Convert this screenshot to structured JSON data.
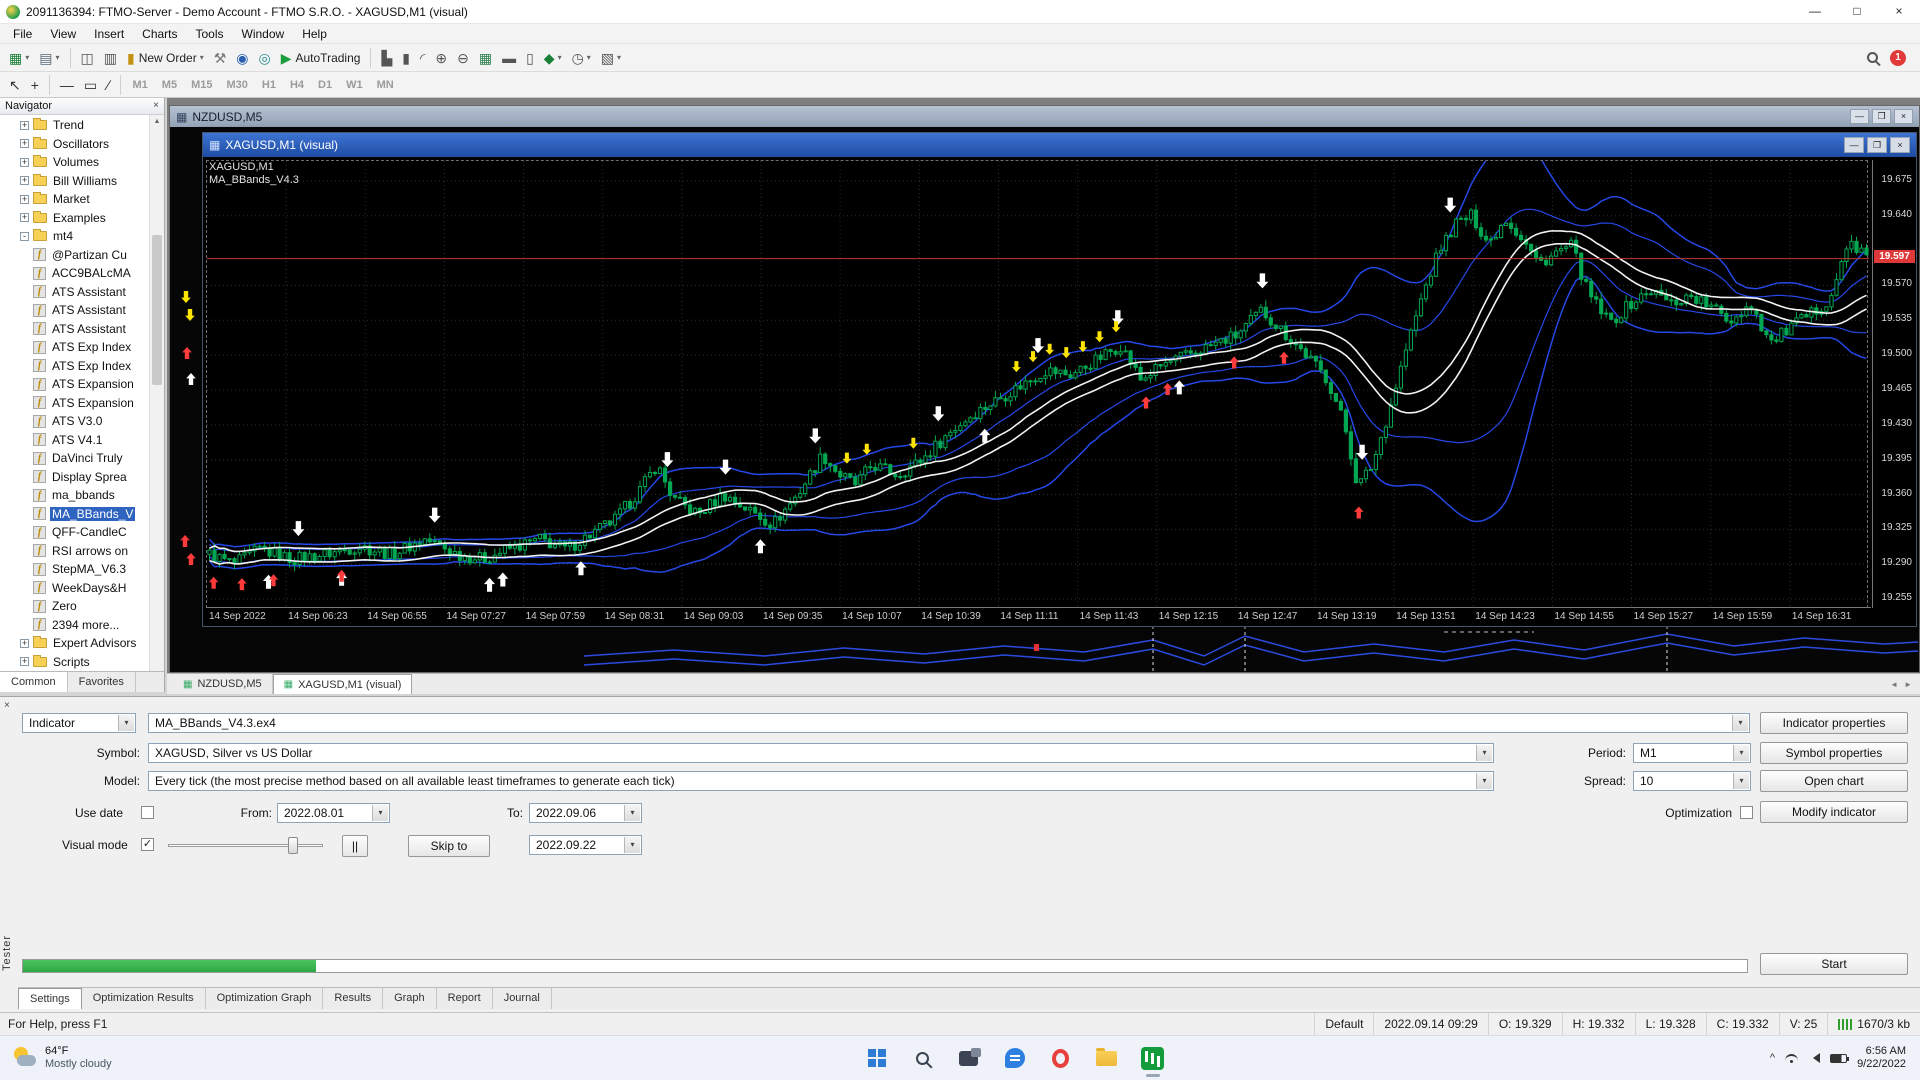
{
  "window": {
    "title": "2091136394: FTMO-Server - Demo Account - FTMO S.R.O. - XAGUSD,M1 (visual)"
  },
  "icons": {
    "minimize": "—",
    "maximize": "□",
    "close": "×",
    "restore": "❐",
    "dropdown": "▾",
    "expand": "+",
    "collapse": "-",
    "check": "✓",
    "left": "◄",
    "right": "►",
    "up": "▲",
    "down": "▼",
    "chart": "▦",
    "chevron_up": "^"
  },
  "menu": [
    "File",
    "View",
    "Insert",
    "Charts",
    "Tools",
    "Window",
    "Help"
  ],
  "toolbar": {
    "notification_count": "1",
    "timeframes": [
      "M1",
      "M5",
      "M15",
      "M30",
      "H1",
      "H4",
      "D1",
      "W1",
      "MN"
    ]
  },
  "toolbar_main": [
    {
      "name": "new-chart",
      "glyph": "▦",
      "color": "#1a7f37",
      "dd": true
    },
    {
      "name": "profiles",
      "glyph": "▤",
      "color": "#5a6a7a",
      "dd": true
    },
    {
      "name": "separator"
    },
    {
      "name": "market-watch",
      "glyph": "◫",
      "color": "#555"
    },
    {
      "name": "data-window",
      "glyph": "▥",
      "color": "#555"
    },
    {
      "name": "new-order",
      "glyph": "▮",
      "color": "#c49110",
      "label": "New Order",
      "dd": true
    },
    {
      "name": "metaeditor",
      "glyph": "⚒",
      "color": "#777"
    },
    {
      "name": "expert-advisors",
      "glyph": "◉",
      "color": "#2b5fb0"
    },
    {
      "name": "options",
      "glyph": "◎",
      "color": "#2a8f8f"
    },
    {
      "name": "autotrading",
      "glyph": "▶",
      "color": "#1a9f3c",
      "label": "AutoTrading"
    },
    {
      "name": "separator"
    },
    {
      "name": "chart-bars",
      "glyph": "▙",
      "color": "#555"
    },
    {
      "name": "chart-candles",
      "glyph": "▮",
      "color": "#555"
    },
    {
      "name": "chart-line",
      "glyph": "◜",
      "color": "#555"
    },
    {
      "name": "zoom-in",
      "glyph": "⊕",
      "color": "#555"
    },
    {
      "name": "zoom-out",
      "glyph": "⊖",
      "color": "#555"
    },
    {
      "name": "tile-windows",
      "glyph": "▦",
      "color": "#2a7f4f"
    },
    {
      "name": "tile-horizontal",
      "glyph": "▬",
      "color": "#555"
    },
    {
      "name": "tile-vertical",
      "glyph": "▯",
      "color": "#555"
    },
    {
      "name": "indicators",
      "glyph": "◆",
      "color": "#1a7f37",
      "dd": true
    },
    {
      "name": "periods",
      "glyph": "◷",
      "color": "#555",
      "dd": true
    },
    {
      "name": "templates",
      "glyph": "▧",
      "color": "#555",
      "dd": true
    }
  ],
  "toolbar_draw": [
    {
      "name": "cursor",
      "glyph": "↖",
      "color": "#333"
    },
    {
      "name": "crosshair",
      "glyph": "+",
      "color": "#333"
    },
    {
      "name": "separator"
    },
    {
      "name": "horizontal-line",
      "glyph": "—",
      "color": "#333"
    },
    {
      "name": "shapes",
      "glyph": "▭",
      "color": "#333"
    },
    {
      "name": "trendline",
      "glyph": "∕",
      "color": "#333"
    },
    {
      "name": "separator"
    }
  ],
  "navigator": {
    "title": "Navigator",
    "folders": [
      "Trend",
      "Oscillators",
      "Volumes",
      "Bill Williams",
      "Market",
      "Examples",
      "mt4"
    ],
    "indicators": [
      "@Partizan Cu",
      "ACC9BALcMA",
      "ATS Assistant",
      "ATS Assistant",
      "ATS Assistant",
      "ATS Exp Index",
      "ATS Exp Index",
      "ATS Expansion",
      "ATS Expansion",
      "ATS V3.0",
      "ATS V4.1",
      "DaVinci Truly",
      "Display Sprea",
      "ma_bbands",
      "MA_BBands_V",
      "QFF-CandleC",
      "RSI arrows on",
      "StepMA_V6.3",
      "WeekDays&H",
      "Zero",
      "2394 more..."
    ],
    "selected_indicator": "MA_BBands_V",
    "bottom_folders": [
      "Expert Advisors",
      "Scripts"
    ],
    "tabs": [
      "Common",
      "Favorites"
    ],
    "active_tab": "Common"
  },
  "charts": {
    "background_window_title": "NZDUSD,M5",
    "active_window_title": "XAGUSD,M1 (visual)",
    "overlay_line1": "XAGUSD,M1",
    "overlay_line2": "MA_BBands_V4.3",
    "current_price": "19.597",
    "price_labels": [
      "19.675",
      "19.640",
      "19.570",
      "19.535",
      "19.500",
      "19.465",
      "19.430",
      "19.395",
      "19.360",
      "19.325",
      "19.290",
      "19.255"
    ],
    "time_labels": [
      "14 Sep 2022",
      "14 Sep 06:23",
      "14 Sep 06:55",
      "14 Sep 07:27",
      "14 Sep 07:59",
      "14 Sep 08:31",
      "14 Sep 09:03",
      "14 Sep 09:35",
      "14 Sep 10:07",
      "14 Sep 10:39",
      "14 Sep 11:11",
      "14 Sep 11:43",
      "14 Sep 12:15",
      "14 Sep 12:47",
      "14 Sep 13:19",
      "14 Sep 13:51",
      "14 Sep 14:23",
      "14 Sep 14:55",
      "14 Sep 15:27",
      "14 Sep 15:59",
      "14 Sep 16:31"
    ],
    "tabs": [
      "NZDUSD,M5",
      "XAGUSD,M1 (visual)"
    ],
    "active_tab": "XAGUSD,M1 (visual)"
  },
  "chart_data": {
    "type": "candlestick",
    "symbol": "XAGUSD",
    "timeframe": "M1",
    "y_range": [
      19.245,
      19.695
    ],
    "price_path": [
      [
        0.0,
        19.3
      ],
      [
        0.015,
        19.29
      ],
      [
        0.03,
        19.305
      ],
      [
        0.05,
        19.295
      ],
      [
        0.07,
        19.3
      ],
      [
        0.09,
        19.308
      ],
      [
        0.11,
        19.3
      ],
      [
        0.13,
        19.315
      ],
      [
        0.15,
        19.3
      ],
      [
        0.165,
        19.295
      ],
      [
        0.18,
        19.305
      ],
      [
        0.2,
        19.315
      ],
      [
        0.215,
        19.305
      ],
      [
        0.23,
        19.32
      ],
      [
        0.245,
        19.335
      ],
      [
        0.26,
        19.365
      ],
      [
        0.27,
        19.39
      ],
      [
        0.28,
        19.355
      ],
      [
        0.295,
        19.34
      ],
      [
        0.31,
        19.36
      ],
      [
        0.325,
        19.345
      ],
      [
        0.34,
        19.33
      ],
      [
        0.355,
        19.36
      ],
      [
        0.37,
        19.4
      ],
      [
        0.38,
        19.38
      ],
      [
        0.39,
        19.37
      ],
      [
        0.4,
        19.39
      ],
      [
        0.415,
        19.38
      ],
      [
        0.43,
        19.395
      ],
      [
        0.445,
        19.42
      ],
      [
        0.46,
        19.44
      ],
      [
        0.475,
        19.455
      ],
      [
        0.49,
        19.47
      ],
      [
        0.505,
        19.485
      ],
      [
        0.52,
        19.48
      ],
      [
        0.535,
        19.495
      ],
      [
        0.55,
        19.51
      ],
      [
        0.562,
        19.475
      ],
      [
        0.575,
        19.49
      ],
      [
        0.59,
        19.5
      ],
      [
        0.605,
        19.51
      ],
      [
        0.62,
        19.52
      ],
      [
        0.635,
        19.545
      ],
      [
        0.65,
        19.52
      ],
      [
        0.662,
        19.5
      ],
      [
        0.675,
        19.475
      ],
      [
        0.685,
        19.43
      ],
      [
        0.693,
        19.368
      ],
      [
        0.702,
        19.39
      ],
      [
        0.712,
        19.445
      ],
      [
        0.722,
        19.505
      ],
      [
        0.732,
        19.56
      ],
      [
        0.742,
        19.605
      ],
      [
        0.752,
        19.632
      ],
      [
        0.762,
        19.64
      ],
      [
        0.772,
        19.612
      ],
      [
        0.782,
        19.638
      ],
      [
        0.792,
        19.618
      ],
      [
        0.802,
        19.592
      ],
      [
        0.812,
        19.602
      ],
      [
        0.822,
        19.61
      ],
      [
        0.832,
        19.562
      ],
      [
        0.845,
        19.532
      ],
      [
        0.858,
        19.552
      ],
      [
        0.87,
        19.565
      ],
      [
        0.882,
        19.552
      ],
      [
        0.894,
        19.56
      ],
      [
        0.906,
        19.548
      ],
      [
        0.918,
        19.535
      ],
      [
        0.93,
        19.552
      ],
      [
        0.942,
        19.512
      ],
      [
        0.954,
        19.528
      ],
      [
        0.966,
        19.54
      ],
      [
        0.978,
        19.558
      ],
      [
        0.99,
        19.615
      ],
      [
        1.0,
        19.598
      ]
    ],
    "signals": {
      "white_down": [
        0.055,
        0.137,
        0.277,
        0.312,
        0.366,
        0.44,
        0.5,
        0.548,
        0.635,
        0.695,
        0.748
      ],
      "white_up": [
        0.037,
        0.081,
        0.17,
        0.178,
        0.225,
        0.333,
        0.468,
        0.585
      ],
      "red_up": [
        0.004,
        0.021,
        0.04,
        0.081,
        0.565,
        0.578,
        0.618,
        0.648,
        0.693
      ],
      "yellow_down": [
        0.385,
        0.397,
        0.425,
        0.487,
        0.497,
        0.507,
        0.517,
        0.527,
        0.537,
        0.547
      ]
    }
  },
  "tester": {
    "panel_label": "Tester",
    "type_value": "Indicator",
    "indicator_value": "MA_BBands_V4.3.ex4",
    "symbol_label": "Symbol:",
    "symbol_value": "XAGUSD, Silver vs US Dollar",
    "model_label": "Model:",
    "model_value": "Every tick (the most precise method based on all available least timeframes to generate each tick)",
    "use_date_label": "Use date",
    "from_label": "From:",
    "from_value": "2022.08.01",
    "to_label": "To:",
    "to_value": "2022.09.06",
    "visual_mode_label": "Visual mode",
    "pause_label": "||",
    "skip_to_label": "Skip to",
    "skip_to_value": "2022.09.22",
    "period_label": "Period:",
    "period_value": "M1",
    "spread_label": "Spread:",
    "spread_value": "10",
    "optimization_label": "Optimization",
    "buttons": {
      "indicator_properties": "Indicator properties",
      "symbol_properties": "Symbol properties",
      "open_chart": "Open chart",
      "modify_indicator": "Modify indicator",
      "start": "Start"
    },
    "progress_percent": 17,
    "tabs": [
      "Settings",
      "Optimization Results",
      "Optimization Graph",
      "Results",
      "Graph",
      "Report",
      "Journal"
    ],
    "active_tab": "Settings"
  },
  "status_bar": {
    "help": "For Help, press F1",
    "profile": "Default",
    "time": "2022.09.14 09:29",
    "ohlc": [
      "O: 19.329",
      "H: 19.332",
      "L: 19.328",
      "C: 19.332",
      "V: 25"
    ],
    "traffic": "1670/3 kb"
  },
  "taskbar": {
    "weather_temp": "64°F",
    "weather_desc": "Mostly cloudy",
    "clock_time": "6:56 AM",
    "clock_date": "9/22/2022"
  }
}
